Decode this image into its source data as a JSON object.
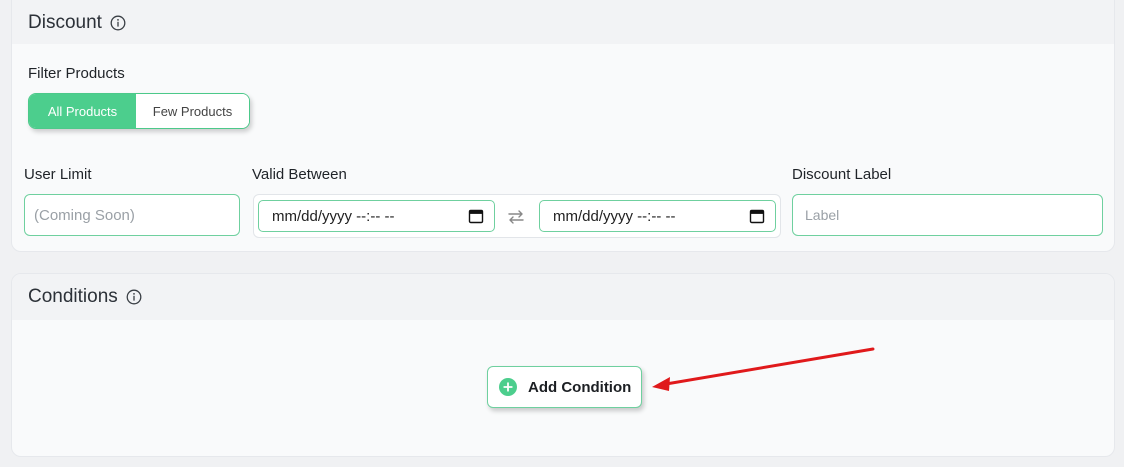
{
  "discount": {
    "title": "Discount",
    "filter_label": "Filter Products",
    "filter_options": [
      {
        "label": "All Products",
        "selected": true
      },
      {
        "label": "Few Products",
        "selected": false
      }
    ],
    "user_limit": {
      "label": "User Limit",
      "placeholder": "(Coming Soon)"
    },
    "valid_between": {
      "label": "Valid Between",
      "start_value": "mm/dd/yyyy --:-- --",
      "end_value": "mm/dd/yyyy --:-- --"
    },
    "discount_label": {
      "label": "Discount Label",
      "placeholder": "Label"
    }
  },
  "conditions": {
    "title": "Conditions",
    "add_button_label": "Add Condition"
  },
  "colors": {
    "accent_green": "#4cce8d",
    "annotation_arrow": "#e0191b"
  }
}
